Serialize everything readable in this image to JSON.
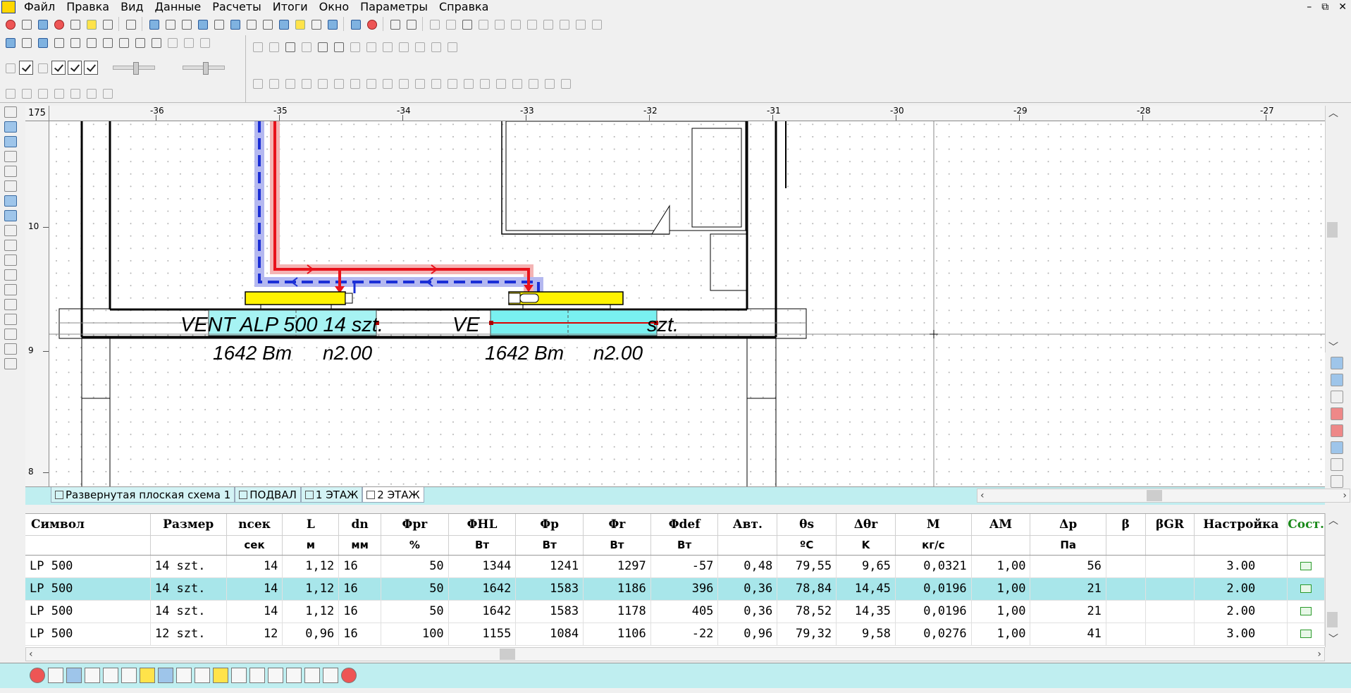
{
  "menu": {
    "items": [
      "Файл",
      "Правка",
      "Вид",
      "Данные",
      "Расчеты",
      "Итоги",
      "Окно",
      "Параметры",
      "Справка"
    ],
    "window_controls": [
      "–",
      "⧉",
      "✕"
    ]
  },
  "ruler": {
    "corner": "175",
    "x_ticks": [
      "-36",
      "-35",
      "-34",
      "-33",
      "-32",
      "-31",
      "-30",
      "-29",
      "-28",
      "-27"
    ],
    "y_ticks": [
      "10",
      "9",
      "8"
    ]
  },
  "drawing": {
    "radiator_left_label": "VENT ALP 500  14 szt.",
    "radiator_right_label_a": "VE",
    "radiator_right_label_b": "szt.",
    "left_power": "1642 Вт",
    "left_setting": "n2.00",
    "right_power": "1642 Вт",
    "right_setting": "n2.00"
  },
  "sheets": {
    "tabs": [
      "Развернутая плоская схема 1",
      "ПОДВАЛ",
      "1 ЭТАЖ",
      "2 ЭТАЖ"
    ],
    "active": "2 ЭТАЖ"
  },
  "table": {
    "headers": [
      "Символ",
      "Размер",
      "nсек",
      "L",
      "dn",
      "Φpr",
      "ΦHL",
      "Φp",
      "Φr",
      "Φdef",
      "Авт.",
      "θs",
      "Δθr",
      "M",
      "AM",
      "Δp",
      "β",
      "βGR",
      "Настройка",
      "Сост."
    ],
    "units": [
      "",
      "",
      "сек",
      "м",
      "мм",
      "%",
      "Вт",
      "Вт",
      "Вт",
      "Вт",
      "",
      "ºC",
      "K",
      "кг/с",
      "",
      "Па",
      "",
      "",
      "",
      ""
    ],
    "rows": [
      [
        "LP 500",
        "14 szt.",
        "14",
        "1,12",
        "16",
        "50",
        "1344",
        "1241",
        "1297",
        "-57",
        "0,48",
        "79,55",
        "9,65",
        "0,0321",
        "1,00",
        "56",
        "",
        "",
        "3.00"
      ],
      [
        "LP 500",
        "14 szt.",
        "14",
        "1,12",
        "16",
        "50",
        "1642",
        "1583",
        "1186",
        "396",
        "0,36",
        "78,84",
        "14,45",
        "0,0196",
        "1,00",
        "21",
        "",
        "",
        "2.00"
      ],
      [
        "LP 500",
        "14 szt.",
        "14",
        "1,12",
        "16",
        "50",
        "1642",
        "1583",
        "1178",
        "405",
        "0,36",
        "78,52",
        "14,35",
        "0,0196",
        "1,00",
        "21",
        "",
        "",
        "2.00"
      ],
      [
        "LP 500",
        "12 szt.",
        "12",
        "0,96",
        "16",
        "100",
        "1155",
        "1084",
        "1106",
        "-22",
        "0,96",
        "79,32",
        "9,58",
        "0,0276",
        "1,00",
        "41",
        "",
        "",
        "3.00"
      ]
    ],
    "selected_row": 1
  },
  "colors": {
    "supply_pipe": "#e8121b",
    "return_pipe": "#1b2fd6",
    "radiator_fill": "#fff200",
    "window_fill": "#79f0f0",
    "selected_row": "#a8e6ea",
    "status_bar": "#bfeef0"
  }
}
